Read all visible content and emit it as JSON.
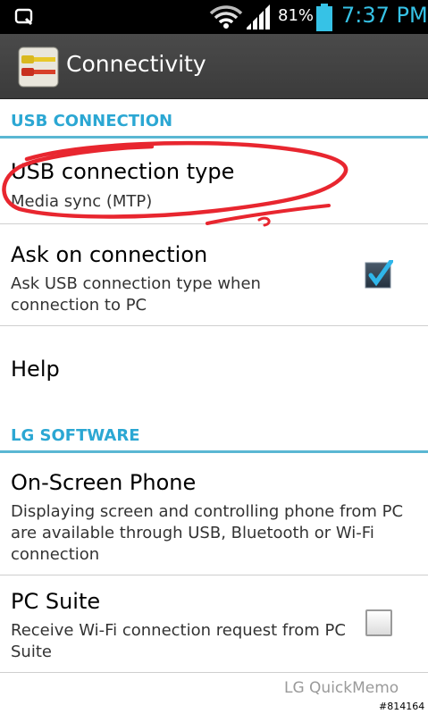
{
  "status_bar": {
    "battery_percent": "81%",
    "time": "7:37 PM",
    "icons": [
      "screen-capture-icon",
      "wifi-icon",
      "signal-icon",
      "battery-icon"
    ]
  },
  "action_bar": {
    "title": "Connectivity",
    "icon": "av-cable-icon"
  },
  "sections": {
    "usb": {
      "header": "USB CONNECTION",
      "items": [
        {
          "title": "USB connection type",
          "subtitle": "Media sync (MTP)"
        },
        {
          "title": "Ask on connection",
          "subtitle": "Ask USB connection type when connection to PC",
          "checked": true
        },
        {
          "title": "Help"
        }
      ]
    },
    "lg_software": {
      "header": "LG SOFTWARE",
      "items": [
        {
          "title": "On-Screen Phone",
          "subtitle": "Displaying screen and controlling phone from PC are available through USB, Bluetooth or Wi-Fi connection"
        },
        {
          "title": "PC Suite",
          "subtitle": "Receive Wi-Fi connection request from PC Suite",
          "checked": false
        }
      ]
    }
  },
  "footer": {
    "watermark": "LG QuickMemo",
    "memo_id": "#814164"
  },
  "colors": {
    "accent": "#2ba7d3",
    "time": "#36c2e6",
    "annotation": "#e8262f",
    "action_bar": "#444444"
  }
}
